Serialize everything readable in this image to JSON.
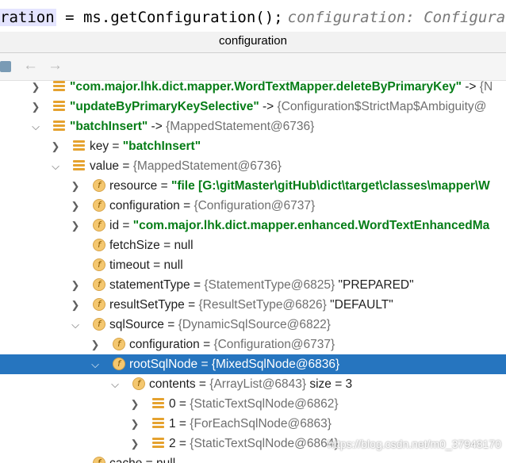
{
  "code_line": {
    "highlighted": "ration",
    "code": " = ms.getConfiguration();",
    "hint": "configuration: Configurat"
  },
  "panel": {
    "title": "configuration"
  },
  "tree": {
    "rows": [
      {
        "name": "\"com.major.lhk.dict.mapper.WordTextMapper.deleteByPrimaryKey\"",
        "eq": " -> ",
        "meta": "{N"
      },
      {
        "name": "\"updateByPrimaryKeySelective\"",
        "eq": " -> ",
        "meta": "{Configuration$StrictMap$Ambiguity@"
      },
      {
        "name": "\"batchInsert\"",
        "eq": " -> ",
        "meta": "{MappedStatement@6736}"
      },
      {
        "name": "key",
        "eq": " = ",
        "value": "\"batchInsert\""
      },
      {
        "name": "value",
        "eq": " = ",
        "meta": "{MappedStatement@6736}"
      },
      {
        "name": "resource",
        "eq": " = ",
        "value": "\"file [G:\\gitMaster\\gitHub\\dict\\target\\classes\\mapper\\W"
      },
      {
        "name": "configuration",
        "eq": " = ",
        "meta": "{Configuration@6737}"
      },
      {
        "name": "id",
        "eq": " = ",
        "value": "\"com.major.lhk.dict.mapper.enhanced.WordTextEnhancedMa"
      },
      {
        "name": "fetchSize",
        "eq": " = ",
        "value": "null"
      },
      {
        "name": "timeout",
        "eq": " = ",
        "value": "null"
      },
      {
        "name": "statementType",
        "eq": " = ",
        "meta": "{StatementType@6825}",
        "value": " \"PREPARED\""
      },
      {
        "name": "resultSetType",
        "eq": " = ",
        "meta": "{ResultSetType@6826}",
        "value": " \"DEFAULT\""
      },
      {
        "name": "sqlSource",
        "eq": " = ",
        "meta": "{DynamicSqlSource@6822}"
      },
      {
        "name": "configuration",
        "eq": " = ",
        "meta": "{Configuration@6737}"
      },
      {
        "name": "rootSqlNode",
        "eq": " = ",
        "meta": "{MixedSqlNode@6836}"
      },
      {
        "name": "contents",
        "eq": " = ",
        "meta": "{ArrayList@6843}",
        "value": "  size = 3"
      },
      {
        "name": "0",
        "eq": " = ",
        "meta": "{StaticTextSqlNode@6862}"
      },
      {
        "name": "1",
        "eq": " = ",
        "meta": "{ForEachSqlNode@6863}"
      },
      {
        "name": "2",
        "eq": " = ",
        "meta": "{StaticTextSqlNode@6864}"
      },
      {
        "name": "cache",
        "eq": " = ",
        "value": "null"
      }
    ]
  },
  "watermark": "https://blog.csdn.net/m0_37948170",
  "colors": {
    "selection": "#2675bf",
    "string_value": "#067d17",
    "field_icon": "#f4c76f"
  }
}
